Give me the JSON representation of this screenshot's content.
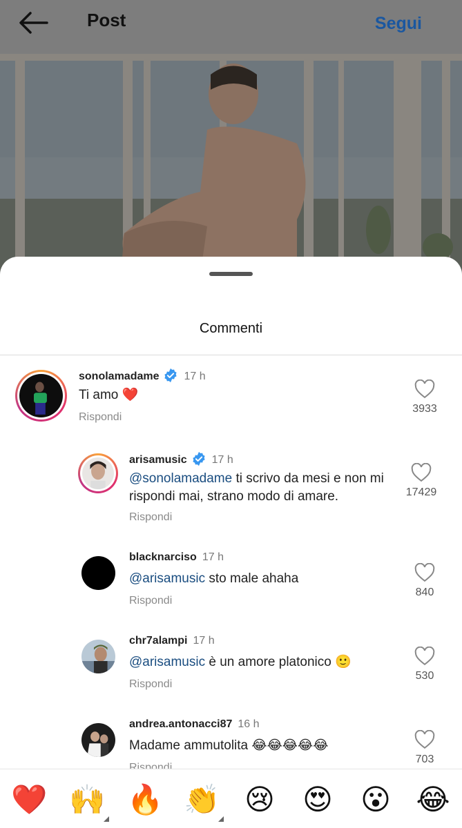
{
  "header": {
    "title": "Post",
    "follow_label": "Segui"
  },
  "sheet": {
    "title": "Commenti"
  },
  "comments": [
    {
      "username": "sonolamadame",
      "verified": true,
      "time": "17 h",
      "mention": "",
      "text": "Ti amo ❤️",
      "reply": "Rispondi",
      "likes": "3933"
    },
    {
      "username": "arisamusic",
      "verified": true,
      "time": "17 h",
      "mention": "@sonolamadame",
      "text": " ti scrivo da mesi e non mi rispondi mai, strano modo di amare.",
      "reply": "Rispondi",
      "likes": "17429"
    },
    {
      "username": "blacknarciso",
      "verified": false,
      "time": "17 h",
      "mention": "@arisamusic",
      "text": " sto male ahaha",
      "reply": "Rispondi",
      "likes": "840"
    },
    {
      "username": "chr7alampi",
      "verified": false,
      "time": "17 h",
      "mention": "@arisamusic",
      "text": " è un amore platonico 🙂",
      "reply": "Rispondi",
      "likes": "530"
    },
    {
      "username": "andrea.antonacci87",
      "verified": false,
      "time": "16 h",
      "mention": "",
      "text": "Madame ammutolita 😂😂😂😂😂",
      "reply": "Rispondi",
      "likes": "703"
    }
  ],
  "emoji_bar": [
    "❤️",
    "🙌",
    "🔥",
    "👏",
    "😢",
    "😍",
    "😮",
    "😂"
  ],
  "colors": {
    "link": "#1a4d80",
    "follow": "#1a57a0",
    "verified": "#3897f0"
  }
}
